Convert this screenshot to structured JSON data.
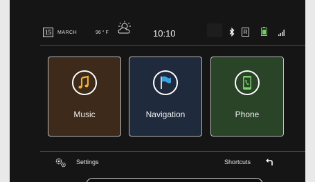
{
  "status_bar": {
    "date_day": "15",
    "date_month": "MARCH",
    "temperature": "96 ° F",
    "time": "10:10",
    "roaming_indicator": "R",
    "icons": [
      "calendar-icon",
      "weather-partly-cloudy-icon",
      "bluetooth-icon",
      "roaming-icon",
      "battery-icon",
      "signal-icon"
    ]
  },
  "tiles": [
    {
      "label": "Music",
      "icon": "music-note-icon",
      "color": "#3d2a1a",
      "accent": "#f0b030"
    },
    {
      "label": "Navigation",
      "icon": "flag-icon",
      "color": "#1f2a3c",
      "accent": "#3aa0e0"
    },
    {
      "label": "Phone",
      "icon": "phone-icon",
      "color": "#2a4428",
      "accent": "#7cd070"
    }
  ],
  "bottom": {
    "settings_label": "Settings",
    "shortcuts_label": "Shortcuts"
  },
  "colors": {
    "screen_bg": "#151515",
    "divider": "#6b4a2e",
    "frame": "#e9e9e9"
  }
}
